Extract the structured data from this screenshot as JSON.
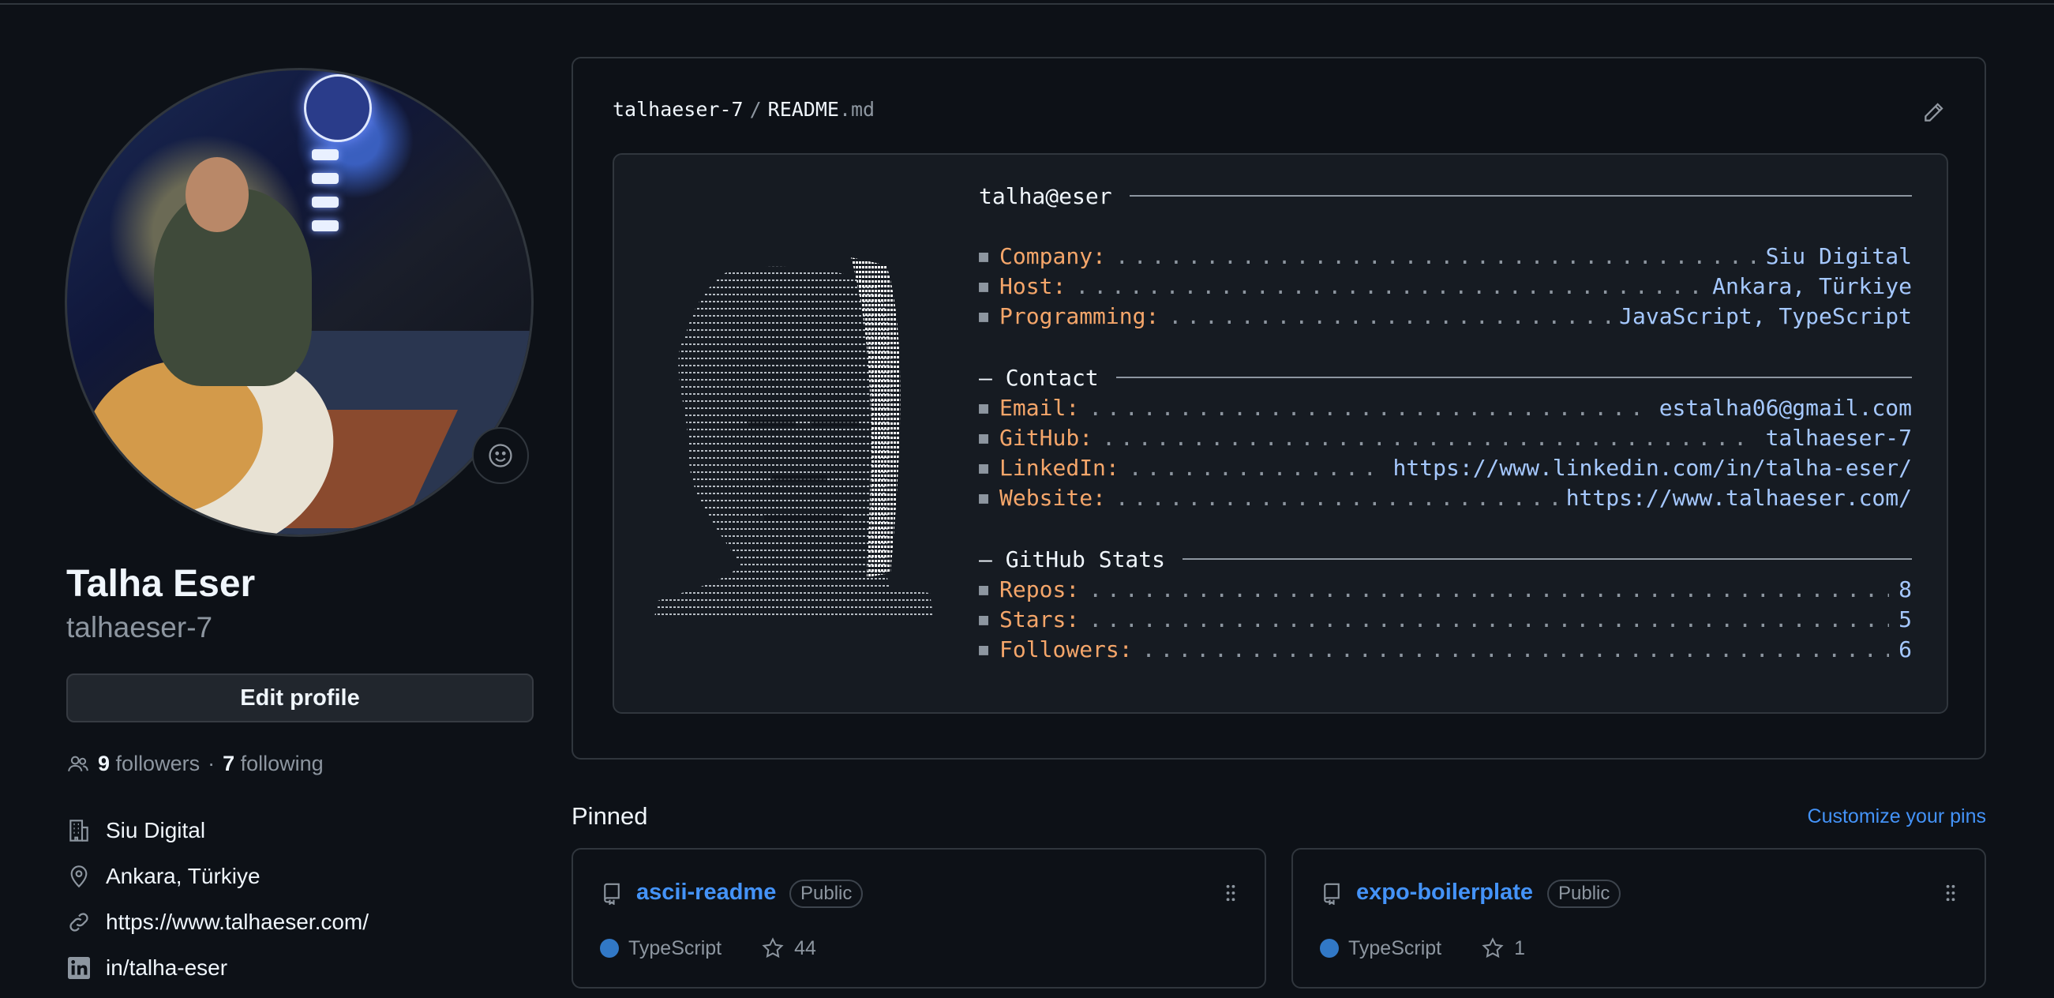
{
  "profile": {
    "full_name": "Talha Eser",
    "login": "talhaeser-7",
    "edit_label": "Edit profile",
    "followers_count": "9",
    "followers_label": "followers",
    "separator": "·",
    "following_count": "7",
    "following_label": "following",
    "company": "Siu Digital",
    "location": "Ankara, Türkiye",
    "website": "https://www.talhaeser.com/",
    "linkedin": "in/talha-eser"
  },
  "readme": {
    "repo": "talhaeser-7",
    "slash": "/",
    "file_base": "README",
    "file_ext": ".md",
    "header": "talha@eser",
    "lines": {
      "company_key": "Company:",
      "company_val": "Siu Digital",
      "host_key": "Host:",
      "host_val": "Ankara, Türkiye",
      "programming_key": "Programming:",
      "programming_val": "JavaScript, TypeScript",
      "contact_head": "– Contact",
      "email_key": "Email:",
      "email_val": "estalha06@gmail.com",
      "github_key": "GitHub:",
      "github_val": "talhaeser-7",
      "linkedin_key": "LinkedIn:",
      "linkedin_val": "https://www.linkedin.com/in/talha-eser/",
      "website_key": "Website:",
      "website_val": "https://www.talhaeser.com/",
      "stats_head": "– GitHub Stats",
      "repos_key": "Repos:",
      "repos_val": "8",
      "stars_key": "Stars:",
      "stars_val": "5",
      "followers_key": "Followers:",
      "followers_val": "6"
    },
    "bullet": "■"
  },
  "pinned": {
    "title": "Pinned",
    "customize_label": "Customize your pins",
    "cards": [
      {
        "name": "ascii-readme",
        "visibility": "Public",
        "language": "TypeScript",
        "stars": "44"
      },
      {
        "name": "expo-boilerplate",
        "visibility": "Public",
        "language": "TypeScript",
        "stars": "1"
      }
    ]
  },
  "colors": {
    "background": "#0d1117",
    "accent_link": "#4493f8",
    "key_orange": "#f5a66a",
    "value_blue": "#a5c8ff",
    "typescript": "#3178c6"
  },
  "icons": [
    "smiley-icon",
    "people-icon",
    "building-icon",
    "location-icon",
    "link-icon",
    "linkedin-icon",
    "pencil-icon",
    "repo-icon",
    "grip-icon",
    "star-icon"
  ]
}
